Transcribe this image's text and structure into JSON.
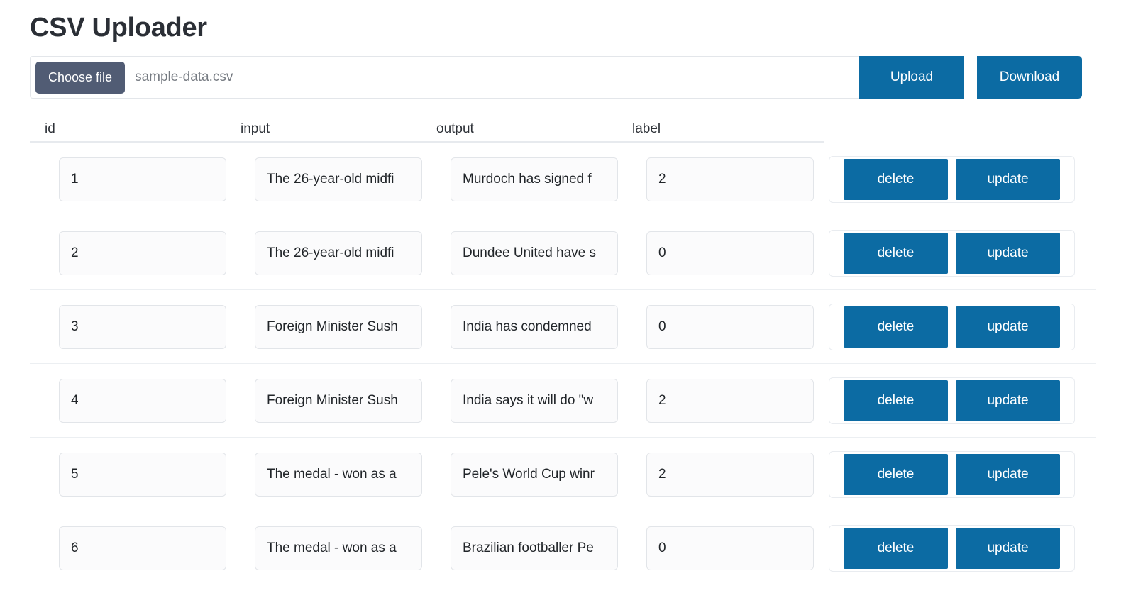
{
  "header": {
    "title": "CSV Uploader"
  },
  "upload_bar": {
    "choose_file_label": "Choose file",
    "file_name": "sample-data.csv",
    "upload_label": "Upload",
    "download_label": "Download"
  },
  "colors": {
    "accent_blue": "#0c6ba3",
    "choose_file_slate": "#515c74",
    "title_text": "#2b2f36",
    "input_bg": "#fbfbfc",
    "input_border": "#e2e5e9",
    "row_divider": "#eceff2"
  },
  "table": {
    "columns": [
      "id",
      "input",
      "output",
      "label"
    ],
    "actions": {
      "delete_label": "delete",
      "update_label": "update"
    },
    "rows": [
      {
        "id": "1",
        "input": "The 26-year-old midfi",
        "output": "Murdoch has signed f",
        "label": "2"
      },
      {
        "id": "2",
        "input": "The 26-year-old midfi",
        "output": "Dundee United have s",
        "label": "0"
      },
      {
        "id": "3",
        "input": "Foreign Minister Sush",
        "output": "India has condemned",
        "label": "0"
      },
      {
        "id": "4",
        "input": "Foreign Minister Sush",
        "output": "India says it will do \"w",
        "label": "2"
      },
      {
        "id": "5",
        "input": "The medal - won as a",
        "output": "Pele's World Cup winr",
        "label": "2"
      },
      {
        "id": "6",
        "input": "The medal - won as a",
        "output": "Brazilian footballer Pe",
        "label": "0"
      }
    ]
  }
}
